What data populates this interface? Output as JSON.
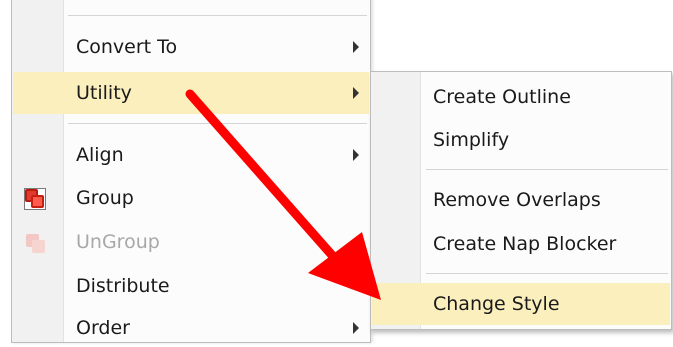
{
  "main_menu": {
    "items": [
      {
        "label": "Convert To",
        "submenu": true
      },
      {
        "label": "Utility",
        "submenu": true,
        "highlighted": true
      },
      {
        "label": "Align",
        "submenu": true
      },
      {
        "label": "Group",
        "icon": "group-icon"
      },
      {
        "label": "UnGroup",
        "icon": "ungroup-icon",
        "disabled": true
      },
      {
        "label": "Distribute"
      },
      {
        "label": "Order",
        "submenu": true
      }
    ]
  },
  "submenu": {
    "items": [
      {
        "label": "Create Outline"
      },
      {
        "label": "Simplify"
      },
      {
        "label": "Remove Overlaps"
      },
      {
        "label": "Create Nap Blocker"
      },
      {
        "label": "Change Style",
        "highlighted": true
      }
    ]
  },
  "annotation": {
    "icon": "red-arrow-icon",
    "color": "#ff0000"
  },
  "colors": {
    "highlight": "#fbefbd",
    "gutter": "#f1f1f1"
  }
}
